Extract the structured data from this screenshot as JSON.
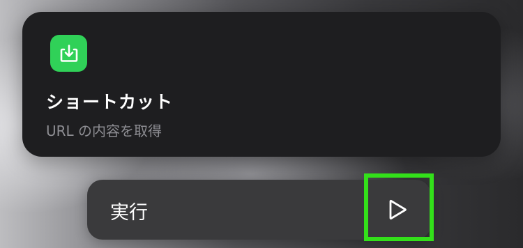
{
  "shortcut_card": {
    "icon": "tray-download-icon",
    "icon_color": "#30d158",
    "title": "ショートカット",
    "subtitle": "URL の内容を取得"
  },
  "run_action": {
    "label": "実行",
    "icon": "play-icon"
  },
  "highlight": {
    "color": "#33e01a",
    "target": "play-button"
  }
}
